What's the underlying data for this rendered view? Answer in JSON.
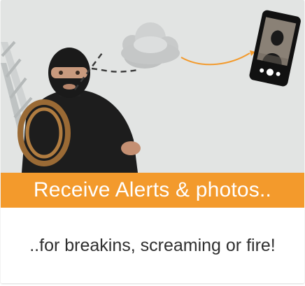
{
  "card": {
    "title": "Receive Alerts & photos..",
    "subtitle": "..for breakins, screaming or fire!"
  },
  "illustration": {
    "icons": [
      "burglar-figure",
      "ladder",
      "cloud-icon",
      "smartphone-icon",
      "arrow"
    ]
  },
  "colors": {
    "accent": "#f39a2c",
    "illustration_bg": "#e2e4e3",
    "text": "#2f2f2f",
    "banner_text": "#ffffff"
  }
}
